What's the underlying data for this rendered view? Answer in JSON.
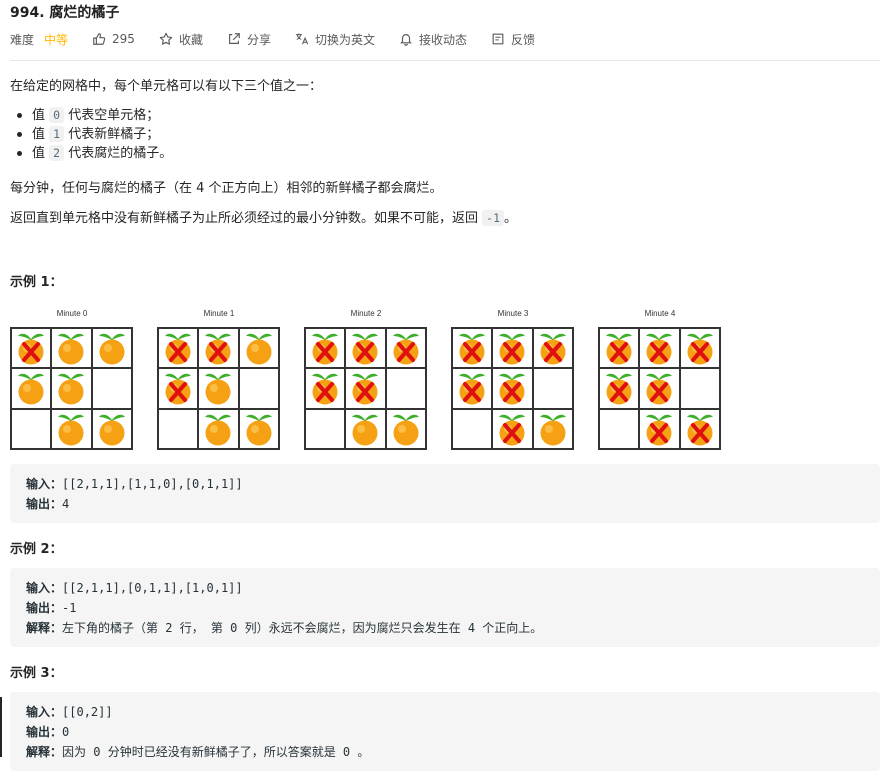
{
  "problem": {
    "title": "994. 腐烂的橘子",
    "difficulty_label": "难度",
    "difficulty_value": "中等",
    "likes": "295",
    "favorite_label": "收藏",
    "share_label": "分享",
    "translate_label": "切换为英文",
    "subscribe_label": "接收动态",
    "feedback_label": "反馈"
  },
  "colors": {
    "difficulty_medium": "#ffb800",
    "code_bg": "#f5f5f5"
  },
  "description": {
    "intro": "在给定的网格中，每个单元格可以有以下三个值之一：",
    "bullets": [
      {
        "pre": "值 ",
        "code": "0",
        "post": " 代表空单元格；"
      },
      {
        "pre": "值 ",
        "code": "1",
        "post": " 代表新鲜橘子；"
      },
      {
        "pre": "值 ",
        "code": "2",
        "post": " 代表腐烂的橘子。"
      }
    ],
    "para2": "每分钟，任何与腐烂的橘子（在 4 个正方向上）相邻的新鲜橘子都会腐烂。",
    "para3_pre": "返回直到单元格中没有新鲜橘子为止所必须经过的最小分钟数。如果不可能，返回 ",
    "para3_code": "-1",
    "para3_post": "。"
  },
  "example1": {
    "heading": "示例 1：",
    "minutes": [
      {
        "caption": "Minute 0",
        "grid": [
          [
            2,
            1,
            1
          ],
          [
            1,
            1,
            0
          ],
          [
            0,
            1,
            1
          ]
        ]
      },
      {
        "caption": "Minute 1",
        "grid": [
          [
            2,
            2,
            1
          ],
          [
            2,
            1,
            0
          ],
          [
            0,
            1,
            1
          ]
        ]
      },
      {
        "caption": "Minute 2",
        "grid": [
          [
            2,
            2,
            2
          ],
          [
            2,
            2,
            0
          ],
          [
            0,
            1,
            1
          ]
        ]
      },
      {
        "caption": "Minute 3",
        "grid": [
          [
            2,
            2,
            2
          ],
          [
            2,
            2,
            0
          ],
          [
            0,
            2,
            1
          ]
        ]
      },
      {
        "caption": "Minute 4",
        "grid": [
          [
            2,
            2,
            2
          ],
          [
            2,
            2,
            0
          ],
          [
            0,
            2,
            2
          ]
        ]
      }
    ],
    "input_label": "输入：",
    "input_value": "[[2,1,1],[1,1,0],[0,1,1]]",
    "output_label": "输出：",
    "output_value": "4"
  },
  "example2": {
    "heading": "示例 2：",
    "input_label": "输入：",
    "input_value": "[[2,1,1],[0,1,1],[1,0,1]]",
    "output_label": "输出：",
    "output_value": "-1",
    "explain_label": "解释：",
    "explain_value": "左下角的橘子（第 2 行， 第 0 列）永远不会腐烂，因为腐烂只会发生在 4 个正向上。"
  },
  "example3": {
    "heading": "示例 3：",
    "input_label": "输入：",
    "input_value": "[[0,2]]",
    "output_label": "输出：",
    "output_value": "0",
    "explain_label": "解释：",
    "explain_value": "因为 0 分钟时已经没有新鲜橘子了，所以答案就是 0 。"
  }
}
